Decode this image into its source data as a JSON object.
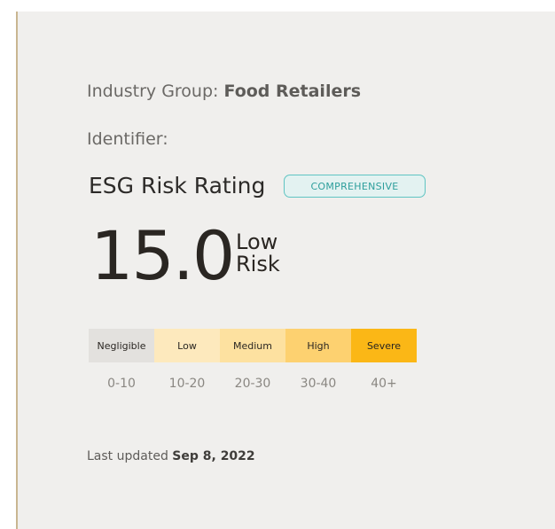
{
  "industry": {
    "label": "Industry Group: ",
    "value": "Food Retailers"
  },
  "identifier": {
    "label": "Identifier:"
  },
  "rating": {
    "title": "ESG Risk Rating",
    "badge": "COMPREHENSIVE",
    "score": "15.0",
    "level_line1": "Low",
    "level_line2": "Risk"
  },
  "scale": [
    {
      "label": "Negligible",
      "range": "0-10",
      "color": "#e3e1de"
    },
    {
      "label": "Low",
      "range": "10-20",
      "color": "#fde9bd"
    },
    {
      "label": "Medium",
      "range": "20-30",
      "color": "#fde1a0"
    },
    {
      "label": "High",
      "range": "30-40",
      "color": "#fdd170"
    },
    {
      "label": "Severe",
      "range": "40+",
      "color": "#fbb716"
    }
  ],
  "updated": {
    "label": "Last updated ",
    "date": "Sep 8, 2022"
  },
  "colors": {
    "accent_border": "#c9b691",
    "badge": "#5fc4c2",
    "text_dark": "#2a2622"
  }
}
